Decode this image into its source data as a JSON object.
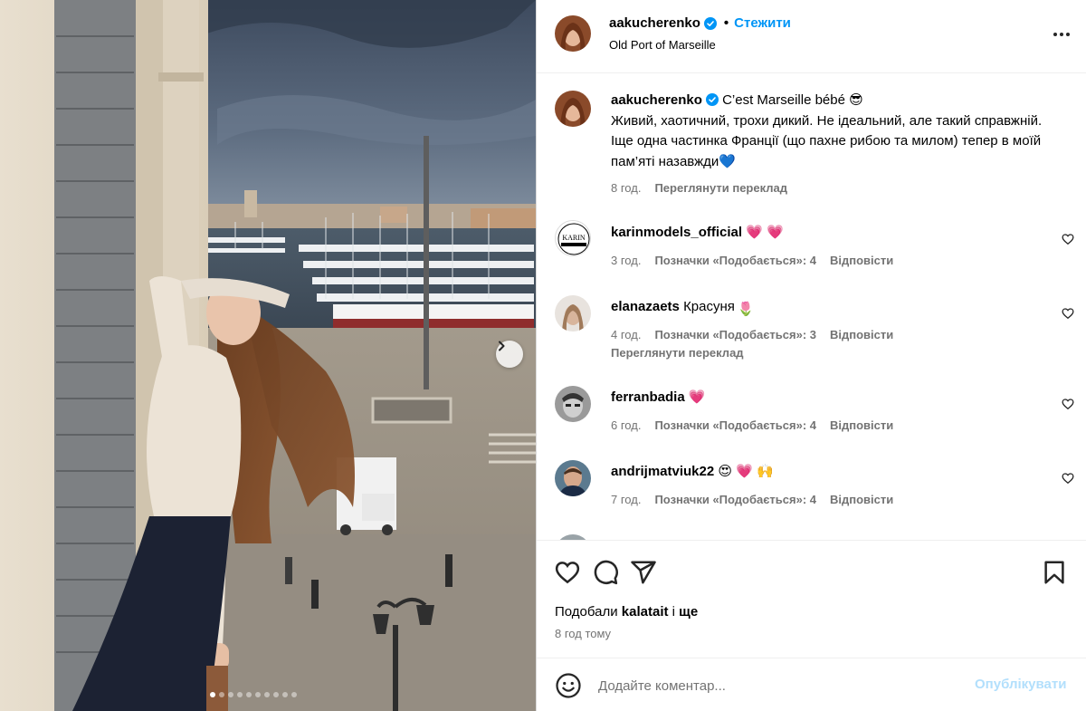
{
  "colors": {
    "accent": "#0095f6",
    "muted": "#737373",
    "border": "#dbdbdb",
    "heart": "#ff3040",
    "verified": "#0095f6",
    "post_disabled": "#b2dffc"
  },
  "header": {
    "username": "aakucherenko",
    "dot": "•",
    "follow_label": "Стежити",
    "location": "Old Port of Marseille",
    "more_icon": "more-horizontal-icon"
  },
  "media": {
    "carousel_total": 10,
    "carousel_active_index": 0,
    "next_icon": "chevron-right-icon"
  },
  "caption": {
    "username": "aakucherenko",
    "text_line1": "C’est Marseille bébé",
    "emoji1": "😎",
    "text_body": "Живий, хаотичний, трохи дикий. Не ідеальний, але такий справжній. Іще одна частинка Франції (що пахне рибою та милом) тепер в моїй пам’яті назавжди",
    "emoji2": "💙",
    "time": "8 год.",
    "translate": "Переглянути переклад"
  },
  "comments": [
    {
      "username": "karinmodels_official",
      "text": "",
      "emoji": "💗 💗",
      "time": "3 год.",
      "likes": "Позначки «Подобається»: 4",
      "reply": "Відповісти",
      "translate": ""
    },
    {
      "username": "elanazaets",
      "text": "Красуня",
      "emoji": "🌷",
      "time": "4 год.",
      "likes": "Позначки «Подобається»: 3",
      "reply": "Відповісти",
      "translate": "Переглянути переклад"
    },
    {
      "username": "ferranbadia",
      "text": "",
      "emoji": "💗",
      "time": "6 год.",
      "likes": "Позначки «Подобається»: 4",
      "reply": "Відповісти",
      "translate": ""
    },
    {
      "username": "andrijmatviuk22",
      "text": "",
      "emoji": "😍 💗 🙌",
      "time": "7 год.",
      "likes": "Позначки «Подобається»: 4",
      "reply": "Відповісти",
      "translate": ""
    }
  ],
  "actions": {
    "liked_by_prefix": "Подобали",
    "liked_by_user": "kalatait",
    "liked_by_and": "і",
    "liked_by_more": "ще",
    "posted_time": "8 год тому"
  },
  "add_comment": {
    "placeholder": "Додайте коментар...",
    "post_label": "Опублікувати"
  }
}
